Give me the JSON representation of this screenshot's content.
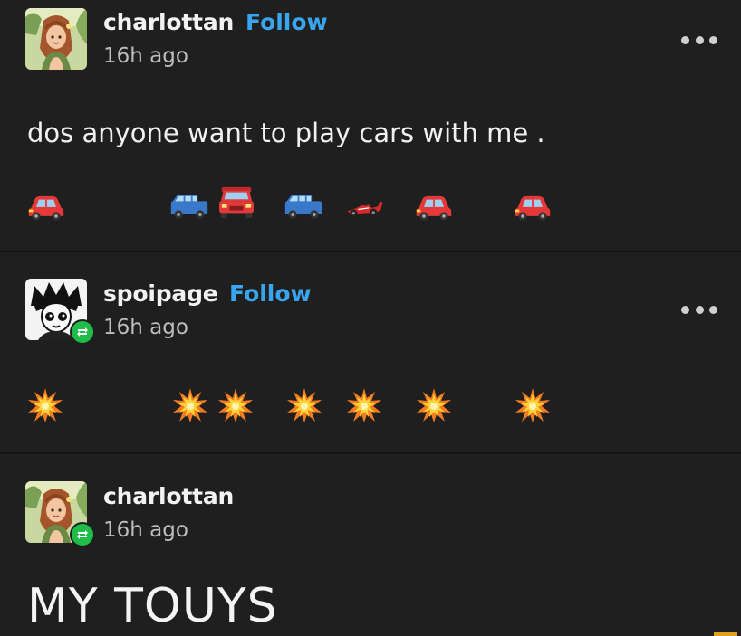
{
  "posts": [
    {
      "username": "charlottan",
      "follow_label": "Follow",
      "time": "16h ago",
      "text": "dos anyone want to play cars with me .",
      "emojis": [
        "red-car",
        "blue-suv",
        "red-car-front",
        "blue-suv",
        "race-car",
        "red-car",
        "red-car"
      ]
    },
    {
      "username": "spoipage",
      "follow_label": "Follow",
      "time": "16h ago",
      "reblog": true,
      "emojis": [
        "collision",
        "collision",
        "collision",
        "collision",
        "collision",
        "collision",
        "collision"
      ]
    },
    {
      "username": "charlottan",
      "time": "16h ago",
      "reblog": true,
      "text": "MY TOUYS"
    }
  ],
  "colors": {
    "background": "#1f1f1f",
    "follow": "#3aa5ef",
    "reblog_badge": "#1fbd48"
  }
}
